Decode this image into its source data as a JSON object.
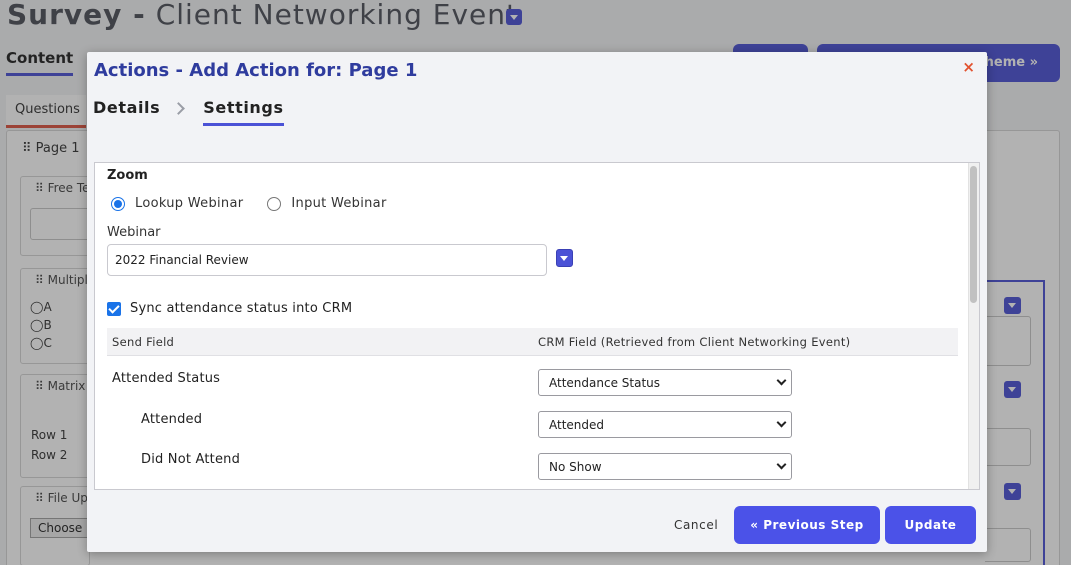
{
  "background": {
    "survey_title_prefix": "Survey -",
    "survey_title_name": "Client Networking Event",
    "content_tab": "Content",
    "theme_button": "Theme »",
    "questions_tab": "Questions",
    "page_label": "⠿ Page 1",
    "cards": [
      {
        "title": "⠿ Free Text"
      },
      {
        "title": "⠿ Multiple Choice"
      },
      {
        "title": "⠿ Matrix"
      },
      {
        "title": "⠿ File Upload"
      }
    ],
    "options": [
      "A",
      "B",
      "C"
    ],
    "rows": [
      "Row 1",
      "Row 2"
    ],
    "choose_button": "Choose"
  },
  "modal": {
    "title": "Actions - Add Action for: Page 1",
    "close_icon": "×",
    "steps": [
      "Details",
      "Settings"
    ],
    "active_step": "Settings",
    "section_label": "Zoom",
    "radio_options": [
      "Lookup Webinar",
      "Input Webinar"
    ],
    "radio_selected": "Lookup Webinar",
    "webinar_label": "Webinar",
    "webinar_value": "2022 Financial Review",
    "sync_label": "Sync attendance status into CRM",
    "sync_checked": true,
    "mapping": {
      "header_send": "Send Field",
      "header_crm": "CRM Field (Retrieved from Client Networking Event)",
      "rows": [
        {
          "label": "Attended Status",
          "value": "Attendance Status"
        },
        {
          "label": "Attended",
          "value": "Attended"
        },
        {
          "label": "Did Not Attend",
          "value": "No Show"
        }
      ]
    },
    "cancel_label": "Cancel",
    "prev_label": "« Previous Step",
    "update_label": "Update"
  },
  "colors": {
    "accent": "#4b52e8",
    "title_blue": "#2f3c9e",
    "close_red": "#e2522f",
    "check_blue": "#1a73e8"
  }
}
